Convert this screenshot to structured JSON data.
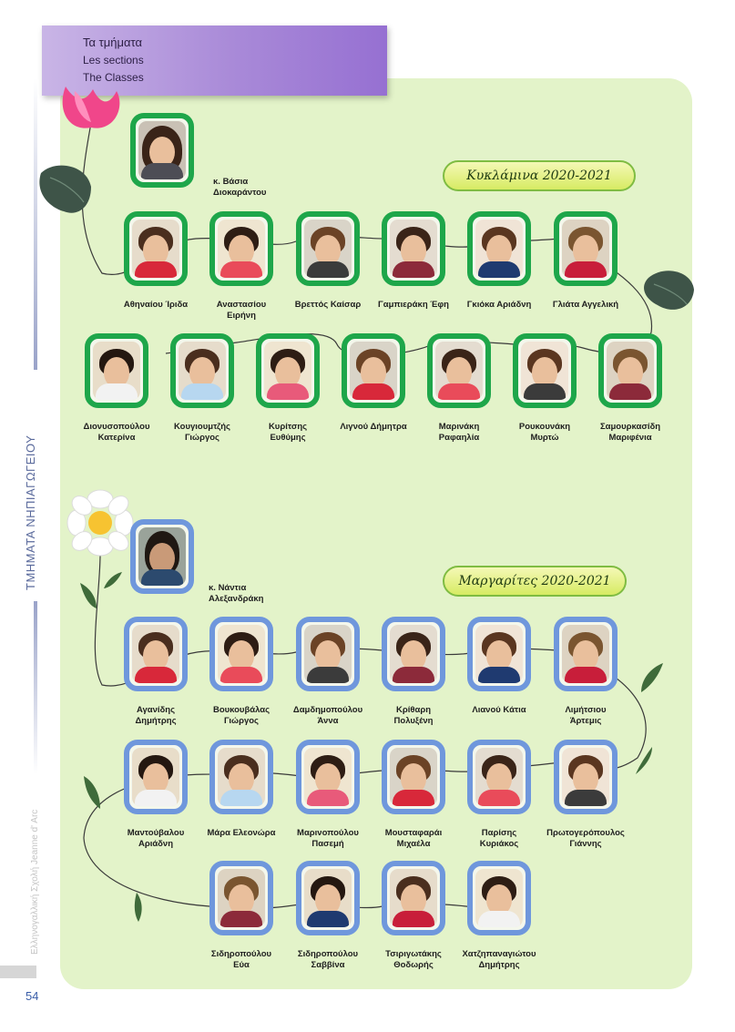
{
  "header": {
    "line1": "Τα τμήματα",
    "line2": "Les sections",
    "line3": "The Classes"
  },
  "side_title": "ΤΜΗΜΑΤΑ ΝΗΠΙΑΓΩΓΕΙΟΥ",
  "credit": "Ελληνογαλλική Σχολή Jeanne d' Arc",
  "page_number": "54",
  "colors": {
    "panel": "#e3f3c9",
    "class1_frame": "#1ea64a",
    "class2_frame": "#6f97dc",
    "header": "#a98ad8"
  },
  "class1": {
    "title": "Κυκλάμινα 2020-2021",
    "teacher": {
      "line1": "κ. Βάσια",
      "line2": "Διοκαράντου"
    },
    "students": [
      {
        "line1": "Αθηναίου Ίριδα",
        "line2": ""
      },
      {
        "line1": "Αναστασίου",
        "line2": "Ειρήνη"
      },
      {
        "line1": "Βρεττός Καίσαρ",
        "line2": ""
      },
      {
        "line1": "Γαμπιεράκη Έφη",
        "line2": ""
      },
      {
        "line1": "Γκιόκα Αριάδνη",
        "line2": ""
      },
      {
        "line1": "Γλιάτα Αγγελική",
        "line2": ""
      },
      {
        "line1": "Διονυσοπούλου",
        "line2": "Κατερίνα"
      },
      {
        "line1": "Κουγιουμτζής",
        "line2": "Γιώργος"
      },
      {
        "line1": "Κυρίτσης",
        "line2": "Ευθύμης"
      },
      {
        "line1": "Λιγνού Δήμητρα",
        "line2": ""
      },
      {
        "line1": "Μαρινάκη",
        "line2": "Ραφαηλία"
      },
      {
        "line1": "Ρουκουνάκη",
        "line2": "Μυρτώ"
      },
      {
        "line1": "Σαμουρκασίδη",
        "line2": "Μαριφένια"
      }
    ]
  },
  "class2": {
    "title": "Μαργαρίτες 2020-2021",
    "teacher": {
      "line1": "κ. Νάντια",
      "line2": "Αλεξανδράκη"
    },
    "students": [
      {
        "line1": "Αγανίδης",
        "line2": "Δημήτρης"
      },
      {
        "line1": "Βουκουβάλας",
        "line2": "Γιώργος"
      },
      {
        "line1": "Δαμδημοπούλου",
        "line2": "Άννα"
      },
      {
        "line1": "Κρίθαρη",
        "line2": "Πολυξένη"
      },
      {
        "line1": "Λιανού Κάτια",
        "line2": ""
      },
      {
        "line1": "Λιμήτσιου",
        "line2": "Άρτεμις"
      },
      {
        "line1": "Μαντούβαλου",
        "line2": "Αριάδνη"
      },
      {
        "line1": "Μάρα Ελεονώρα",
        "line2": ""
      },
      {
        "line1": "Μαρινοπούλου",
        "line2": "Πασεμή"
      },
      {
        "line1": "Μουσταφαράι",
        "line2": "Μιχαέλα"
      },
      {
        "line1": "Παρίσης",
        "line2": "Κυριάκος"
      },
      {
        "line1": "Πρωτογερόπουλος",
        "line2": "Γιάννης"
      },
      {
        "line1": "Σιδηροπούλου",
        "line2": "Εύα"
      },
      {
        "line1": "Σιδηροπούλου",
        "line2": "Σαββίνα"
      },
      {
        "line1": "Τσιριγωτάκης",
        "line2": "Θοδωρής"
      },
      {
        "line1": "Χατζηπαναγιώτου",
        "line2": "Δημήτρης"
      }
    ]
  }
}
